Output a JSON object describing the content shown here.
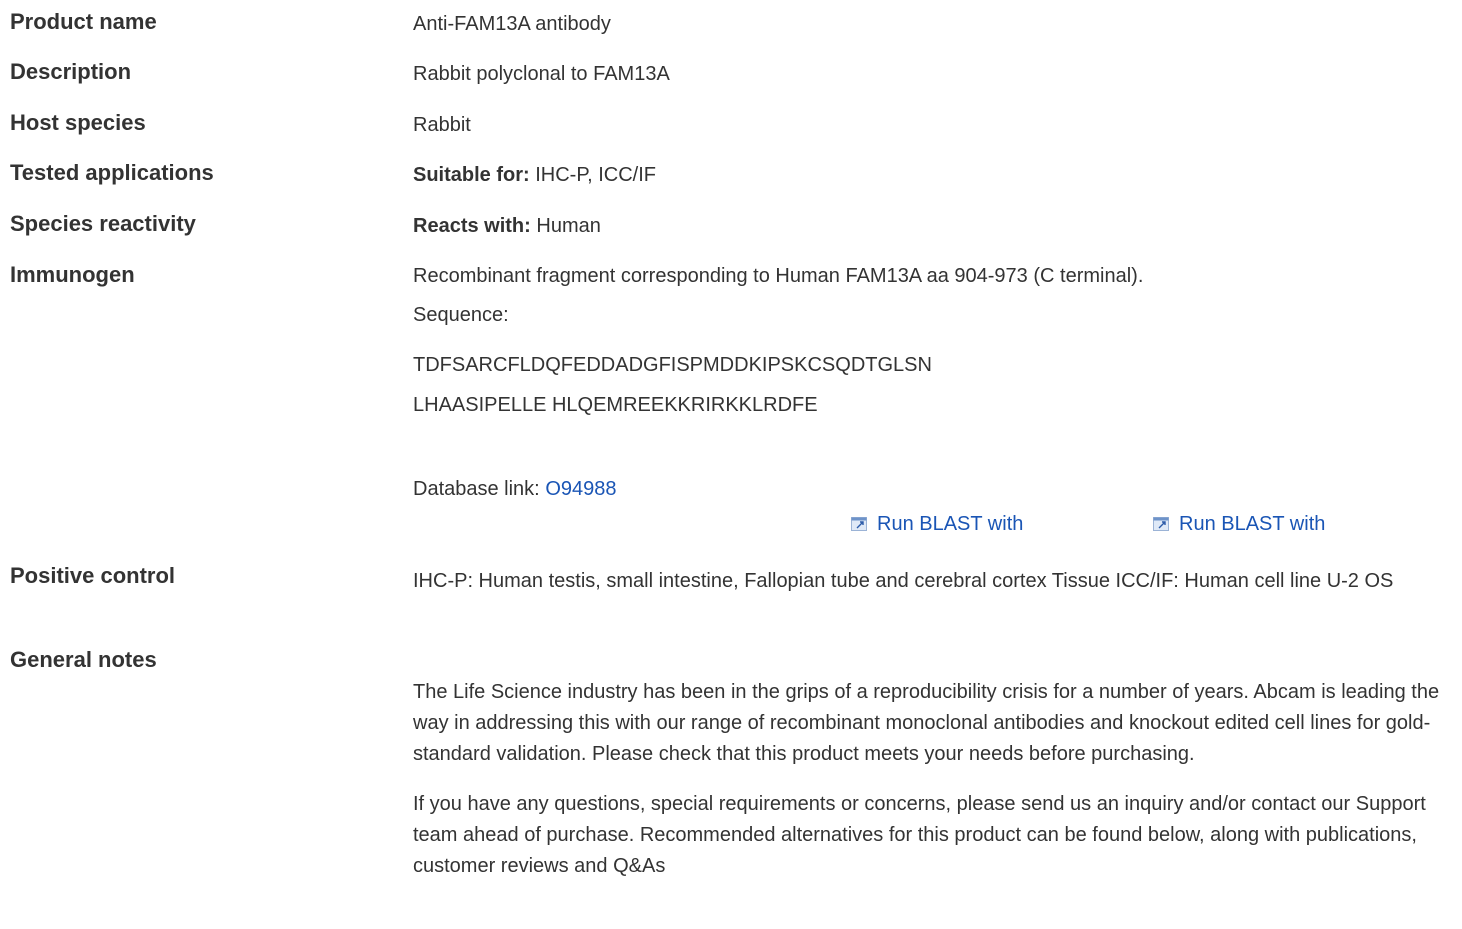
{
  "product_name": {
    "label": "Product name",
    "value": "Anti-FAM13A antibody"
  },
  "description": {
    "label": "Description",
    "value": "Rabbit polyclonal to FAM13A"
  },
  "host_species": {
    "label": "Host species",
    "value": "Rabbit"
  },
  "tested_applications": {
    "label": "Tested applications",
    "prefix": "Suitable for:",
    "value": "IHC-P, ICC/IF"
  },
  "species_reactivity": {
    "label": "Species reactivity",
    "prefix": "Reacts with:",
    "value": "Human"
  },
  "immunogen": {
    "label": "Immunogen",
    "line1": "Recombinant fragment corresponding to Human FAM13A aa 904-973 (C terminal).",
    "sequence_label": "Sequence:",
    "sequence_line1": "TDFSARCFLDQFEDDADGFISPMDDKIPSKCSQDTGLSN",
    "sequence_line2": "LHAASIPELLE HLQEMREEKKRIRKKLRDFE",
    "db_label": "Database link:",
    "db_link": "O94988",
    "blast_1": "Run BLAST with",
    "blast_2": "Run BLAST with"
  },
  "positive_control": {
    "label": "Positive control",
    "value": "IHC-P: Human testis, small intestine, Fallopian tube and cerebral cortex Tissue ICC/IF: Human cell line U-2 OS"
  },
  "general_notes": {
    "label": "General notes",
    "para1": "The Life Science industry has been in the grips of a reproducibility crisis for a number of years. Abcam is leading the way in addressing this with our range of recombinant monoclonal antibodies and knockout edited cell lines for gold-standard validation. Please check that this product meets your needs before purchasing.",
    "para2": "If you have any questions, special requirements or concerns, please send us an inquiry and/or contact our Support team ahead of purchase. Recommended alternatives for this product can be found below, along with publications, customer reviews and Q&As"
  },
  "icons": {
    "blast": "external-link-icon"
  },
  "colors": {
    "link": "#1a55b5",
    "text": "#333333"
  }
}
